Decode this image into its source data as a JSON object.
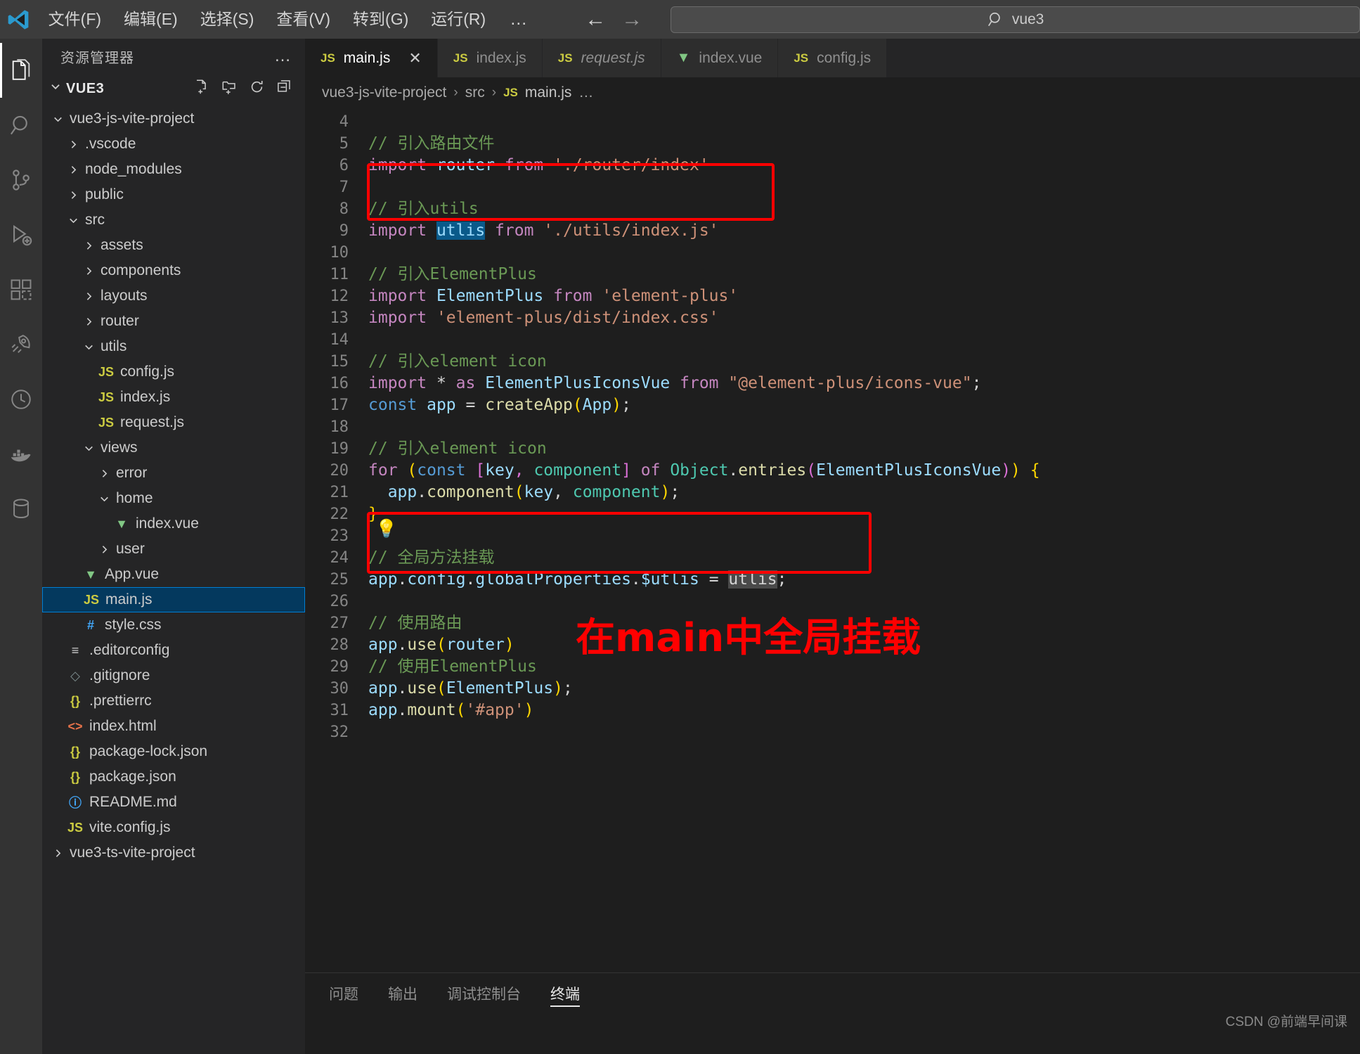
{
  "titlebar": {
    "logo_icon": "vscode-logo-icon",
    "menus": [
      "文件(F)",
      "编辑(E)",
      "选择(S)",
      "查看(V)",
      "转到(G)",
      "运行(R)"
    ],
    "more_label": "…",
    "back_icon": "arrow-left-icon",
    "forward_icon": "arrow-right-icon",
    "search": {
      "icon": "search-icon",
      "value": "vue3",
      "placeholder": "vue3"
    }
  },
  "activitybar": {
    "items": [
      {
        "name": "explorer",
        "icon": "files-icon",
        "active": true
      },
      {
        "name": "search",
        "icon": "search-icon",
        "active": false
      },
      {
        "name": "source-control",
        "icon": "source-control-icon",
        "active": false
      },
      {
        "name": "run-debug",
        "icon": "run-debug-icon",
        "active": false
      },
      {
        "name": "extensions",
        "icon": "extensions-icon",
        "active": false
      },
      {
        "name": "rocket",
        "icon": "rocket-icon",
        "active": false
      },
      {
        "name": "clock",
        "icon": "clock-icon",
        "active": false
      },
      {
        "name": "docker",
        "icon": "docker-icon",
        "active": false
      },
      {
        "name": "database",
        "icon": "database-icon",
        "active": false
      }
    ]
  },
  "sidebar": {
    "header_title": "资源管理器",
    "header_more": "…",
    "root": {
      "label": "VUE3",
      "expanded": true
    },
    "actions": [
      "new-file-icon",
      "new-folder-icon",
      "refresh-icon",
      "collapse-all-icon"
    ],
    "tree": [
      {
        "label": "vue3-js-vite-project",
        "indent": 1,
        "kind": "folder",
        "expanded": true
      },
      {
        "label": ".vscode",
        "indent": 2,
        "kind": "folder",
        "expanded": false
      },
      {
        "label": "node_modules",
        "indent": 2,
        "kind": "folder",
        "expanded": false
      },
      {
        "label": "public",
        "indent": 2,
        "kind": "folder",
        "expanded": false
      },
      {
        "label": "src",
        "indent": 2,
        "kind": "folder",
        "expanded": true
      },
      {
        "label": "assets",
        "indent": 3,
        "kind": "folder",
        "expanded": false
      },
      {
        "label": "components",
        "indent": 3,
        "kind": "folder",
        "expanded": false
      },
      {
        "label": "layouts",
        "indent": 3,
        "kind": "folder",
        "expanded": false
      },
      {
        "label": "router",
        "indent": 3,
        "kind": "folder",
        "expanded": false
      },
      {
        "label": "utils",
        "indent": 3,
        "kind": "folder",
        "expanded": true
      },
      {
        "label": "config.js",
        "indent": 4,
        "kind": "js"
      },
      {
        "label": "index.js",
        "indent": 4,
        "kind": "js"
      },
      {
        "label": "request.js",
        "indent": 4,
        "kind": "js"
      },
      {
        "label": "views",
        "indent": 3,
        "kind": "folder",
        "expanded": true
      },
      {
        "label": "error",
        "indent": 4,
        "kind": "folder",
        "expanded": false
      },
      {
        "label": "home",
        "indent": 4,
        "kind": "folder",
        "expanded": true
      },
      {
        "label": "index.vue",
        "indent": 5,
        "kind": "vue"
      },
      {
        "label": "user",
        "indent": 4,
        "kind": "folder",
        "expanded": false
      },
      {
        "label": "App.vue",
        "indent": 3,
        "kind": "vue"
      },
      {
        "label": "main.js",
        "indent": 3,
        "kind": "js",
        "selected": true
      },
      {
        "label": "style.css",
        "indent": 3,
        "kind": "css"
      },
      {
        "label": ".editorconfig",
        "indent": 2,
        "kind": "editorconfig"
      },
      {
        "label": ".gitignore",
        "indent": 2,
        "kind": "git"
      },
      {
        "label": ".prettierrc",
        "indent": 2,
        "kind": "json"
      },
      {
        "label": "index.html",
        "indent": 2,
        "kind": "html"
      },
      {
        "label": "package-lock.json",
        "indent": 2,
        "kind": "json"
      },
      {
        "label": "package.json",
        "indent": 2,
        "kind": "json"
      },
      {
        "label": "README.md",
        "indent": 2,
        "kind": "md"
      },
      {
        "label": "vite.config.js",
        "indent": 2,
        "kind": "js"
      },
      {
        "label": "vue3-ts-vite-project",
        "indent": 1,
        "kind": "folder",
        "expanded": false
      }
    ]
  },
  "tabs": [
    {
      "label": "main.js",
      "kind": "js",
      "active": true,
      "italic": false,
      "close_icon": "close-icon"
    },
    {
      "label": "index.js",
      "kind": "js",
      "active": false,
      "italic": false
    },
    {
      "label": "request.js",
      "kind": "js",
      "active": false,
      "italic": true
    },
    {
      "label": "index.vue",
      "kind": "vue",
      "active": false,
      "italic": false
    },
    {
      "label": "config.js",
      "kind": "js",
      "active": false,
      "italic": false
    }
  ],
  "breadcrumb": {
    "items": [
      "vue3-js-vite-project",
      "src",
      "main.js",
      "…"
    ],
    "separator": "›",
    "file_icon": "js-file-icon"
  },
  "editor": {
    "first_line": 4,
    "lines": [
      {
        "n": 4,
        "tokens": []
      },
      {
        "n": 5,
        "tokens": [
          {
            "t": "// 引入路由文件",
            "c": "cmt"
          }
        ]
      },
      {
        "n": 6,
        "tokens": [
          {
            "t": "import ",
            "c": "k"
          },
          {
            "t": "router",
            "c": "id"
          },
          {
            "t": " from ",
            "c": "k"
          },
          {
            "t": "'./router/index'",
            "c": "str"
          }
        ]
      },
      {
        "n": 7,
        "tokens": []
      },
      {
        "n": 8,
        "tokens": [
          {
            "t": "// 引入utils",
            "c": "cmt"
          }
        ]
      },
      {
        "n": 9,
        "tokens": [
          {
            "t": "import ",
            "c": "k"
          },
          {
            "t": "utlis",
            "c": "sel"
          },
          {
            "t": " from ",
            "c": "k"
          },
          {
            "t": "'./utils/index.js'",
            "c": "str"
          }
        ]
      },
      {
        "n": 10,
        "tokens": []
      },
      {
        "n": 11,
        "tokens": [
          {
            "t": "// 引入ElementPlus",
            "c": "cmt"
          }
        ]
      },
      {
        "n": 12,
        "tokens": [
          {
            "t": "import ",
            "c": "k"
          },
          {
            "t": "ElementPlus",
            "c": "id"
          },
          {
            "t": " from ",
            "c": "k"
          },
          {
            "t": "'element-plus'",
            "c": "str"
          }
        ]
      },
      {
        "n": 13,
        "tokens": [
          {
            "t": "import ",
            "c": "k"
          },
          {
            "t": "'element-plus/dist/index.css'",
            "c": "str"
          }
        ]
      },
      {
        "n": 14,
        "tokens": []
      },
      {
        "n": 15,
        "tokens": [
          {
            "t": "// 引入element icon",
            "c": "cmt"
          }
        ]
      },
      {
        "n": 16,
        "tokens": [
          {
            "t": "import ",
            "c": "k"
          },
          {
            "t": "* ",
            "c": "op"
          },
          {
            "t": "as ",
            "c": "k"
          },
          {
            "t": "ElementPlusIconsVue",
            "c": "id"
          },
          {
            "t": " from ",
            "c": "k"
          },
          {
            "t": "\"@element-plus/icons-vue\"",
            "c": "str"
          },
          {
            "t": ";",
            "c": "op"
          }
        ]
      },
      {
        "n": 17,
        "tokens": [
          {
            "t": "const ",
            "c": "kc"
          },
          {
            "t": "app",
            "c": "id"
          },
          {
            "t": " = ",
            "c": "op"
          },
          {
            "t": "createApp",
            "c": "fn"
          },
          {
            "t": "(",
            "c": "pn"
          },
          {
            "t": "App",
            "c": "id"
          },
          {
            "t": ")",
            "c": "pn"
          },
          {
            "t": ";",
            "c": "op"
          }
        ]
      },
      {
        "n": 18,
        "tokens": []
      },
      {
        "n": 19,
        "tokens": [
          {
            "t": "// 引入element icon",
            "c": "cmt"
          }
        ]
      },
      {
        "n": 20,
        "tokens": [
          {
            "t": "for ",
            "c": "k"
          },
          {
            "t": "(",
            "c": "pn"
          },
          {
            "t": "const ",
            "c": "kc"
          },
          {
            "t": "[",
            "c": "pp"
          },
          {
            "t": "key",
            "c": "id"
          },
          {
            "t": ", ",
            "c": "pp"
          },
          {
            "t": "component",
            "c": "cls"
          },
          {
            "t": "]",
            "c": "pp"
          },
          {
            "t": " of ",
            "c": "k"
          },
          {
            "t": "Object",
            "c": "cls"
          },
          {
            "t": ".",
            "c": "op"
          },
          {
            "t": "entries",
            "c": "fn"
          },
          {
            "t": "(",
            "c": "pp"
          },
          {
            "t": "ElementPlusIconsVue",
            "c": "id"
          },
          {
            "t": ")",
            "c": "pp"
          },
          {
            "t": ")",
            "c": "pn"
          },
          {
            "t": " {",
            "c": "pn"
          }
        ]
      },
      {
        "n": 21,
        "tokens": [
          {
            "t": "  ",
            "c": "op"
          },
          {
            "t": "app",
            "c": "id"
          },
          {
            "t": ".",
            "c": "op"
          },
          {
            "t": "component",
            "c": "fn"
          },
          {
            "t": "(",
            "c": "pn"
          },
          {
            "t": "key",
            "c": "id"
          },
          {
            "t": ", ",
            "c": "op"
          },
          {
            "t": "component",
            "c": "cls"
          },
          {
            "t": ")",
            "c": "pn"
          },
          {
            "t": ";",
            "c": "op"
          }
        ]
      },
      {
        "n": 22,
        "tokens": [
          {
            "t": "}",
            "c": "pn"
          }
        ]
      },
      {
        "n": 23,
        "tokens": []
      },
      {
        "n": 24,
        "tokens": [
          {
            "t": "// 全局方法挂载",
            "c": "cmt"
          }
        ]
      },
      {
        "n": 25,
        "tokens": [
          {
            "t": "app",
            "c": "id"
          },
          {
            "t": ".",
            "c": "op"
          },
          {
            "t": "config",
            "c": "id"
          },
          {
            "t": ".",
            "c": "op"
          },
          {
            "t": "globalProperties",
            "c": "id"
          },
          {
            "t": ".",
            "c": "op"
          },
          {
            "t": "$utlis",
            "c": "id"
          },
          {
            "t": " = ",
            "c": "op"
          },
          {
            "t": "utlis",
            "c": "selg"
          },
          {
            "t": ";",
            "c": "op"
          }
        ]
      },
      {
        "n": 26,
        "tokens": []
      },
      {
        "n": 27,
        "tokens": [
          {
            "t": "// 使用路由",
            "c": "cmt"
          }
        ]
      },
      {
        "n": 28,
        "tokens": [
          {
            "t": "app",
            "c": "id"
          },
          {
            "t": ".",
            "c": "op"
          },
          {
            "t": "use",
            "c": "fn"
          },
          {
            "t": "(",
            "c": "pn"
          },
          {
            "t": "router",
            "c": "id"
          },
          {
            "t": ")",
            "c": "pn"
          }
        ]
      },
      {
        "n": 29,
        "tokens": [
          {
            "t": "// 使用ElementPlus",
            "c": "cmt"
          }
        ]
      },
      {
        "n": 30,
        "tokens": [
          {
            "t": "app",
            "c": "id"
          },
          {
            "t": ".",
            "c": "op"
          },
          {
            "t": "use",
            "c": "fn"
          },
          {
            "t": "(",
            "c": "pn"
          },
          {
            "t": "ElementPlus",
            "c": "id"
          },
          {
            "t": ")",
            "c": "pn"
          },
          {
            "t": ";",
            "c": "op"
          }
        ]
      },
      {
        "n": 31,
        "tokens": [
          {
            "t": "app",
            "c": "id"
          },
          {
            "t": ".",
            "c": "op"
          },
          {
            "t": "mount",
            "c": "fn"
          },
          {
            "t": "(",
            "c": "pn"
          },
          {
            "t": "'#app'",
            "c": "str"
          },
          {
            "t": ")",
            "c": "pn"
          }
        ]
      },
      {
        "n": 32,
        "tokens": []
      }
    ]
  },
  "annotations": {
    "box1": {
      "name": "red-highlight-box-import-utils"
    },
    "box2": {
      "name": "red-highlight-box-global-mount"
    },
    "bulb_icon": "lightbulb-icon",
    "note_text": "在main中全局挂载",
    "note_color": "#ff0000"
  },
  "panel": {
    "tabs": [
      "问题",
      "输出",
      "调试控制台",
      "终端"
    ],
    "active_tab": "终端",
    "watermark": "CSDN @前端早间课"
  }
}
